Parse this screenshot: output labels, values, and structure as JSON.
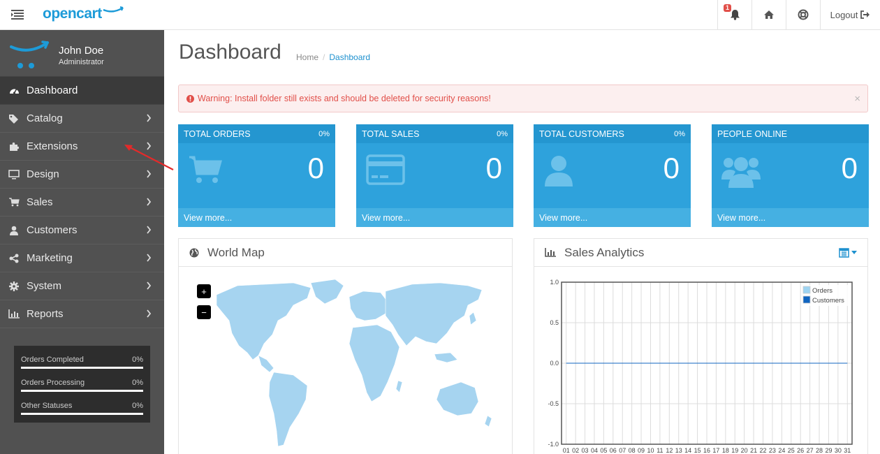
{
  "header": {
    "logo": "opencart",
    "notification_count": "1",
    "logout_label": "Logout"
  },
  "sidebar": {
    "user_name": "John Doe",
    "user_role": "Administrator",
    "items": [
      {
        "label": "Dashboard",
        "icon": "dashboard-icon",
        "active": true
      },
      {
        "label": "Catalog",
        "icon": "tags-icon"
      },
      {
        "label": "Extensions",
        "icon": "puzzle-icon"
      },
      {
        "label": "Design",
        "icon": "monitor-icon"
      },
      {
        "label": "Sales",
        "icon": "cart-icon"
      },
      {
        "label": "Customers",
        "icon": "user-icon"
      },
      {
        "label": "Marketing",
        "icon": "share-icon"
      },
      {
        "label": "System",
        "icon": "gear-icon"
      },
      {
        "label": "Reports",
        "icon": "bar-chart-icon"
      }
    ],
    "stats": [
      {
        "label": "Orders Completed",
        "value": "0%",
        "fraction": 0
      },
      {
        "label": "Orders Processing",
        "value": "0%",
        "fraction": 0
      },
      {
        "label": "Other Statuses",
        "value": "0%",
        "fraction": 0
      }
    ]
  },
  "main": {
    "title": "Dashboard",
    "breadcrumb": [
      "Home",
      "Dashboard"
    ],
    "alert": "Warning: Install folder still exists and should be deleted for security reasons!",
    "alert_close": "×",
    "tiles": [
      {
        "title": "TOTAL ORDERS",
        "percent": "0%",
        "value": "0",
        "link": "View more...",
        "icon": "cart-icon"
      },
      {
        "title": "TOTAL SALES",
        "percent": "0%",
        "value": "0",
        "link": "View more...",
        "icon": "credit-card-icon"
      },
      {
        "title": "TOTAL CUSTOMERS",
        "percent": "0%",
        "value": "0",
        "link": "View more...",
        "icon": "user-icon"
      },
      {
        "title": "PEOPLE ONLINE",
        "percent": "",
        "value": "0",
        "link": "View more...",
        "icon": "users-icon"
      }
    ],
    "map_panel": {
      "title": "World Map",
      "zoom_in": "+",
      "zoom_out": "−"
    },
    "analytics_panel": {
      "title": "Sales Analytics"
    }
  },
  "colors": {
    "accent": "#1e91cf",
    "tile": "#2ea2dc",
    "sidebar": "#515151",
    "alert_text": "#e14f49"
  },
  "chart_data": {
    "type": "line",
    "x": [
      "01",
      "02",
      "03",
      "04",
      "05",
      "06",
      "07",
      "08",
      "09",
      "10",
      "11",
      "12",
      "13",
      "14",
      "15",
      "16",
      "17",
      "18",
      "19",
      "20",
      "21",
      "22",
      "23",
      "24",
      "25",
      "26",
      "27",
      "28",
      "29",
      "30",
      "31"
    ],
    "series": [
      {
        "name": "Orders",
        "color": "#9ed4f2",
        "values": [
          0,
          0,
          0,
          0,
          0,
          0,
          0,
          0,
          0,
          0,
          0,
          0,
          0,
          0,
          0,
          0,
          0,
          0,
          0,
          0,
          0,
          0,
          0,
          0,
          0,
          0,
          0,
          0,
          0,
          0,
          0
        ]
      },
      {
        "name": "Customers",
        "color": "#1065c0",
        "values": [
          0,
          0,
          0,
          0,
          0,
          0,
          0,
          0,
          0,
          0,
          0,
          0,
          0,
          0,
          0,
          0,
          0,
          0,
          0,
          0,
          0,
          0,
          0,
          0,
          0,
          0,
          0,
          0,
          0,
          0,
          0
        ]
      }
    ],
    "ylim": [
      -1.0,
      1.0
    ],
    "yticks": [
      "1.0",
      "0.5",
      "0.0",
      "-0.5",
      "-1.0"
    ],
    "grid": true,
    "legend": "top-right"
  }
}
